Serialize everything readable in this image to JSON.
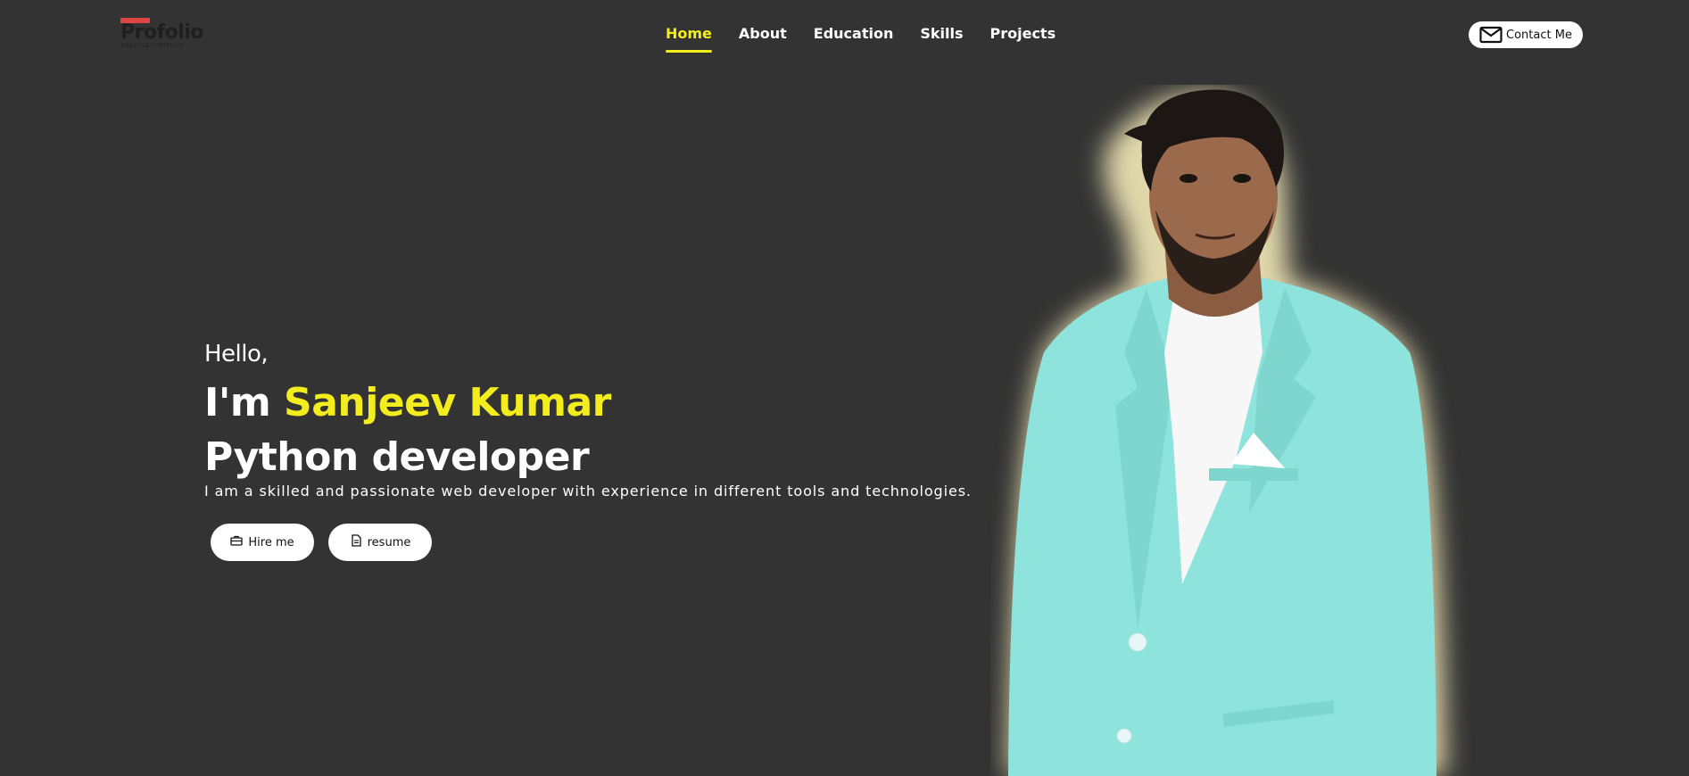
{
  "brand": {
    "name": "Profolio",
    "tagline": "CREATIVE PORTFOLIO",
    "accent": "#e04545"
  },
  "nav": {
    "items": [
      {
        "label": "Home",
        "active": true
      },
      {
        "label": "About",
        "active": false
      },
      {
        "label": "Education",
        "active": false
      },
      {
        "label": "Skills",
        "active": false
      },
      {
        "label": "Projects",
        "active": false
      }
    ],
    "active_color": "#f3ed1e"
  },
  "contact": {
    "label": "Contact Me",
    "icon": "mail-icon"
  },
  "hero": {
    "greeting": "Hello,",
    "intro_prefix": "I'm ",
    "name": "Sanjeev Kumar",
    "role": "Python developer",
    "description": "I am a skilled and passionate web developer with experience in different tools and technologies.",
    "buttons": {
      "hire": {
        "label": "Hire me",
        "icon": "briefcase-icon"
      },
      "resume": {
        "label": "resume",
        "icon": "document-icon"
      }
    },
    "highlight_color": "#f3ed1e"
  },
  "portrait": {
    "suit_color": "#8ee4dd",
    "glow_color": "#fff6c8"
  },
  "colors": {
    "background": "#333333"
  }
}
